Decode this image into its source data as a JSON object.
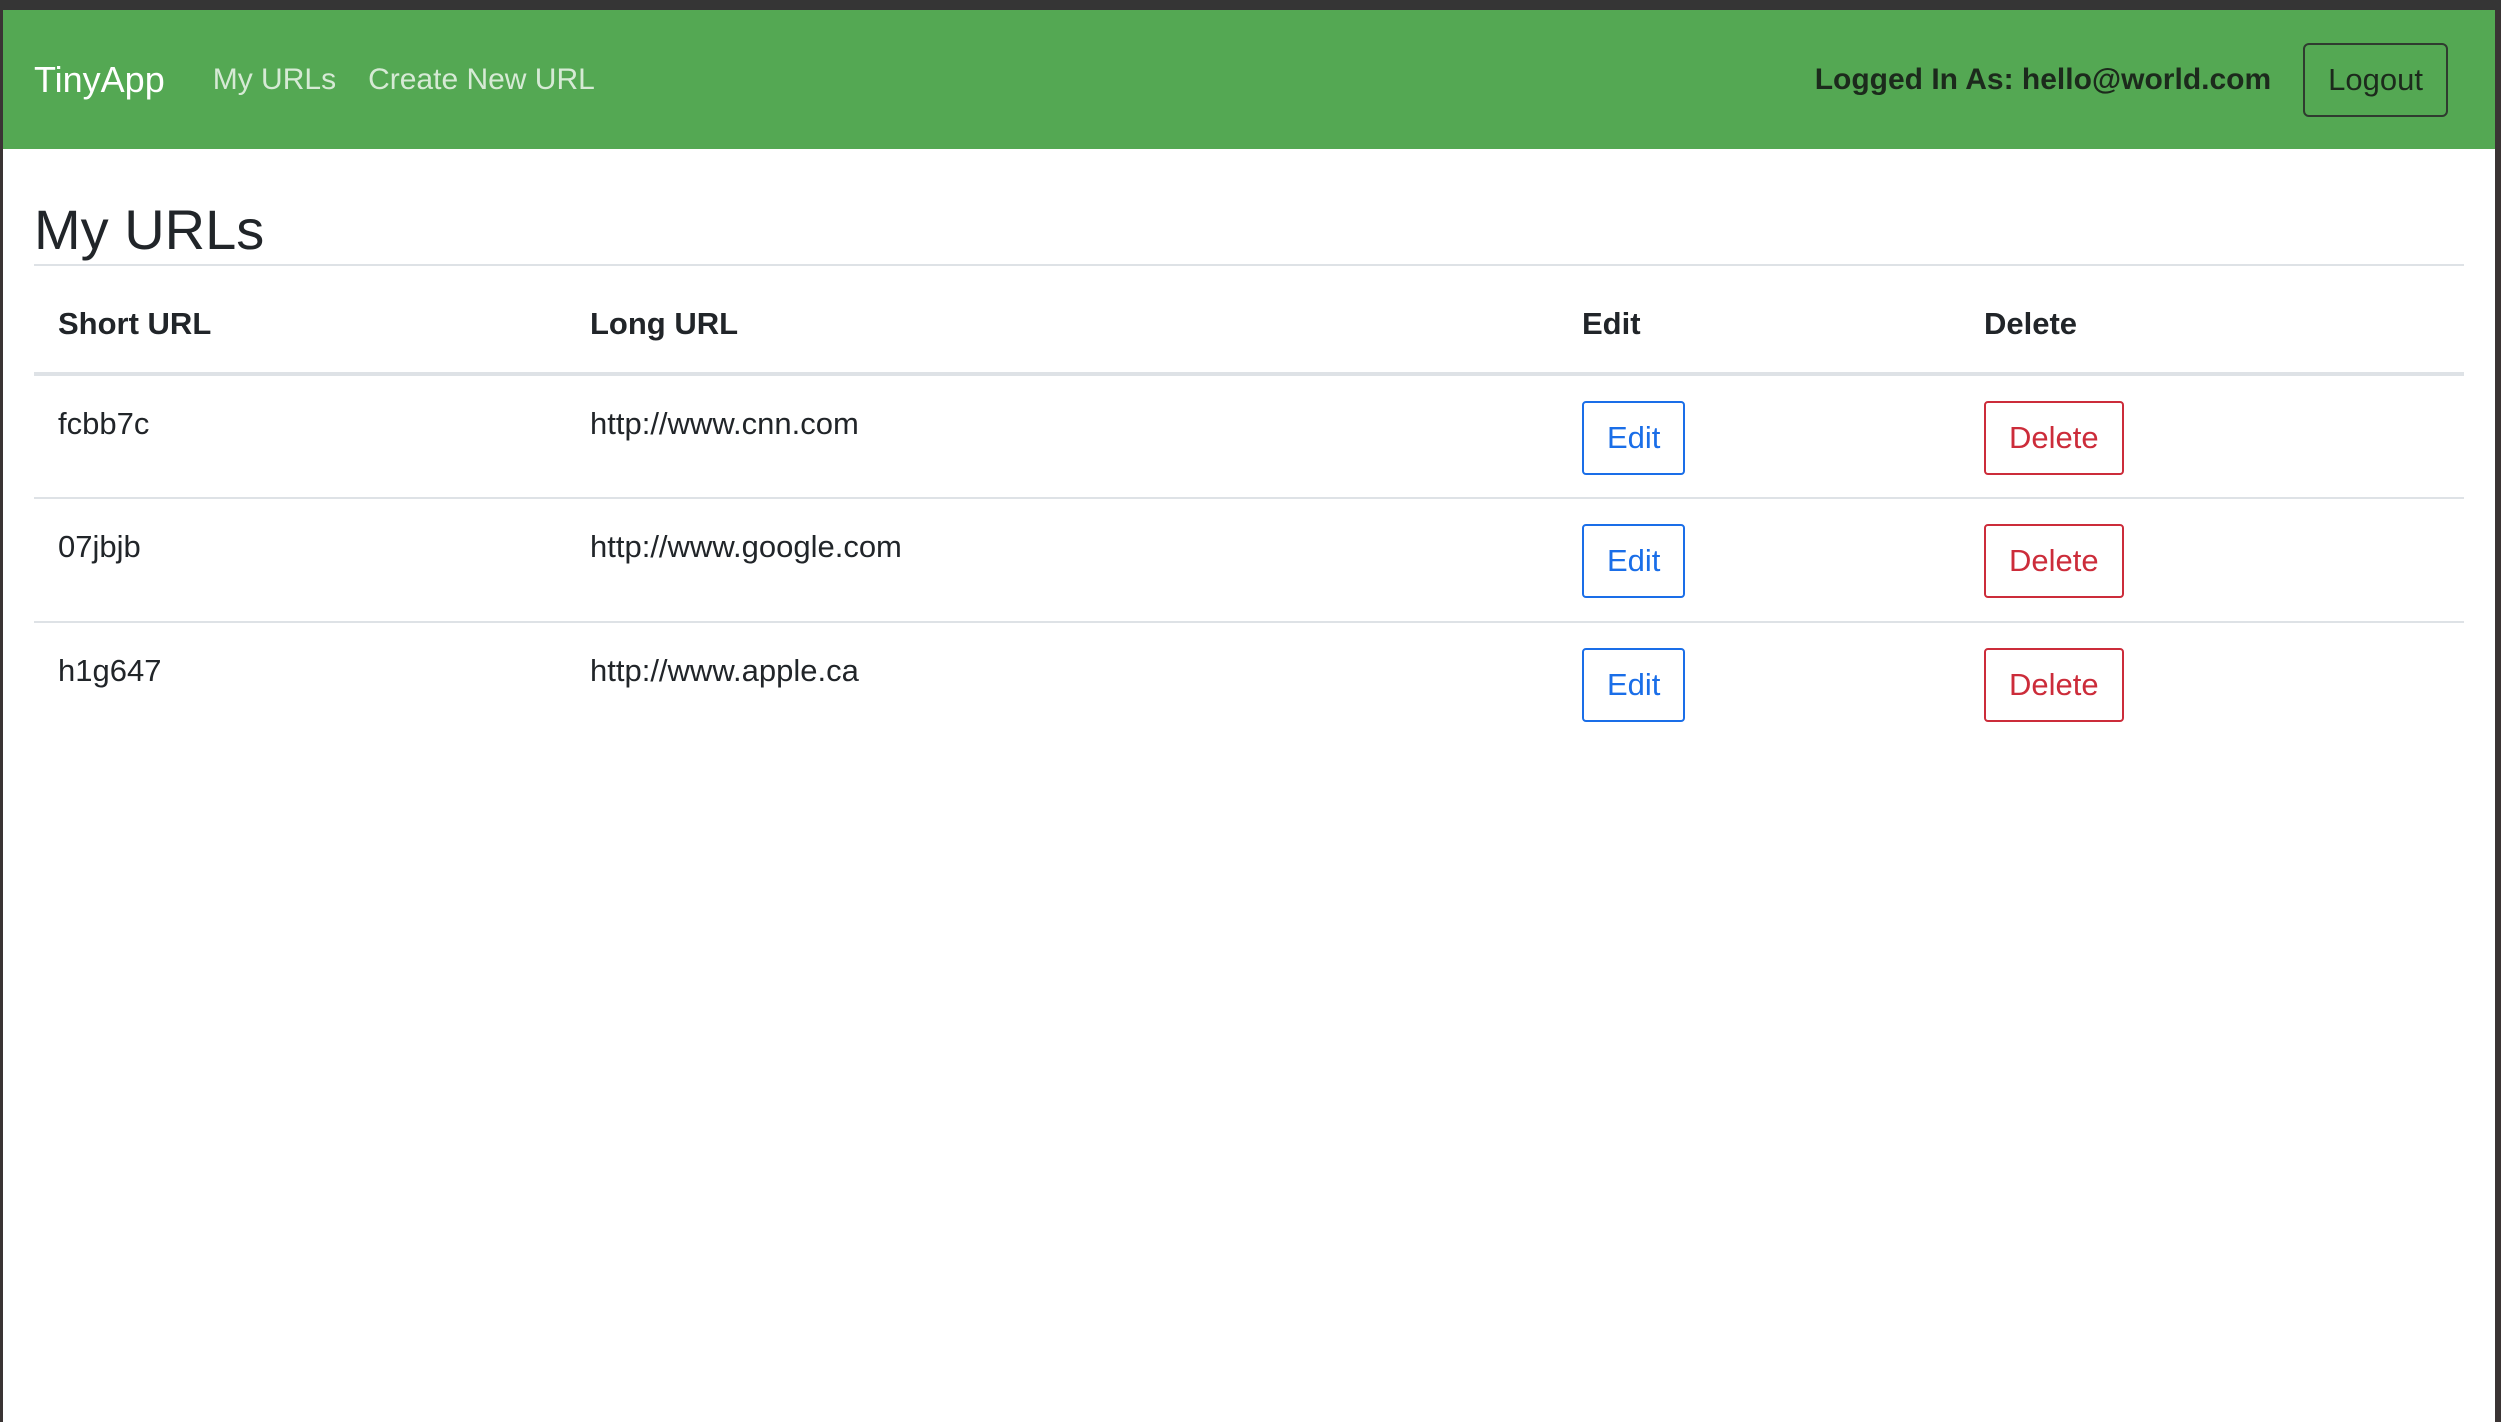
{
  "navbar": {
    "brand": "TinyApp",
    "links": [
      "My URLs",
      "Create New URL"
    ],
    "logged_in_text": "Logged In As: hello@world.com",
    "logout_label": "Logout",
    "background_color": "#54a853"
  },
  "main": {
    "title": "My URLs",
    "table": {
      "headers": [
        "Short URL",
        "Long URL",
        "Edit",
        "Delete"
      ],
      "rows": [
        {
          "short_url": "fcbb7c",
          "long_url": "http://www.cnn.com",
          "edit_label": "Edit",
          "delete_label": "Delete"
        },
        {
          "short_url": "07jbjb",
          "long_url": "http://www.google.com",
          "edit_label": "Edit",
          "delete_label": "Delete"
        },
        {
          "short_url": "h1g647",
          "long_url": "http://www.apple.ca",
          "edit_label": "Edit",
          "delete_label": "Delete"
        }
      ]
    }
  },
  "colors": {
    "edit_button": "#1a6ee8",
    "delete_button": "#cc2c3a"
  }
}
